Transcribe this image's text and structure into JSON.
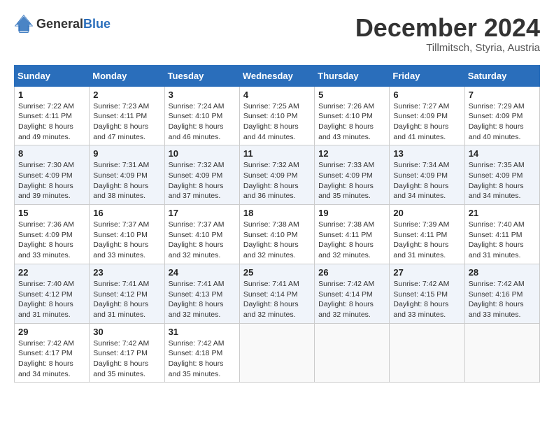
{
  "header": {
    "logo_general": "General",
    "logo_blue": "Blue",
    "month_title": "December 2024",
    "subtitle": "Tillmitsch, Styria, Austria"
  },
  "days_of_week": [
    "Sunday",
    "Monday",
    "Tuesday",
    "Wednesday",
    "Thursday",
    "Friday",
    "Saturday"
  ],
  "weeks": [
    [
      {
        "day": "1",
        "sunrise": "7:22 AM",
        "sunset": "4:11 PM",
        "daylight": "8 hours and 49 minutes."
      },
      {
        "day": "2",
        "sunrise": "7:23 AM",
        "sunset": "4:11 PM",
        "daylight": "8 hours and 47 minutes."
      },
      {
        "day": "3",
        "sunrise": "7:24 AM",
        "sunset": "4:10 PM",
        "daylight": "8 hours and 46 minutes."
      },
      {
        "day": "4",
        "sunrise": "7:25 AM",
        "sunset": "4:10 PM",
        "daylight": "8 hours and 44 minutes."
      },
      {
        "day": "5",
        "sunrise": "7:26 AM",
        "sunset": "4:10 PM",
        "daylight": "8 hours and 43 minutes."
      },
      {
        "day": "6",
        "sunrise": "7:27 AM",
        "sunset": "4:09 PM",
        "daylight": "8 hours and 41 minutes."
      },
      {
        "day": "7",
        "sunrise": "7:29 AM",
        "sunset": "4:09 PM",
        "daylight": "8 hours and 40 minutes."
      }
    ],
    [
      {
        "day": "8",
        "sunrise": "7:30 AM",
        "sunset": "4:09 PM",
        "daylight": "8 hours and 39 minutes."
      },
      {
        "day": "9",
        "sunrise": "7:31 AM",
        "sunset": "4:09 PM",
        "daylight": "8 hours and 38 minutes."
      },
      {
        "day": "10",
        "sunrise": "7:32 AM",
        "sunset": "4:09 PM",
        "daylight": "8 hours and 37 minutes."
      },
      {
        "day": "11",
        "sunrise": "7:32 AM",
        "sunset": "4:09 PM",
        "daylight": "8 hours and 36 minutes."
      },
      {
        "day": "12",
        "sunrise": "7:33 AM",
        "sunset": "4:09 PM",
        "daylight": "8 hours and 35 minutes."
      },
      {
        "day": "13",
        "sunrise": "7:34 AM",
        "sunset": "4:09 PM",
        "daylight": "8 hours and 34 minutes."
      },
      {
        "day": "14",
        "sunrise": "7:35 AM",
        "sunset": "4:09 PM",
        "daylight": "8 hours and 34 minutes."
      }
    ],
    [
      {
        "day": "15",
        "sunrise": "7:36 AM",
        "sunset": "4:09 PM",
        "daylight": "8 hours and 33 minutes."
      },
      {
        "day": "16",
        "sunrise": "7:37 AM",
        "sunset": "4:10 PM",
        "daylight": "8 hours and 33 minutes."
      },
      {
        "day": "17",
        "sunrise": "7:37 AM",
        "sunset": "4:10 PM",
        "daylight": "8 hours and 32 minutes."
      },
      {
        "day": "18",
        "sunrise": "7:38 AM",
        "sunset": "4:10 PM",
        "daylight": "8 hours and 32 minutes."
      },
      {
        "day": "19",
        "sunrise": "7:38 AM",
        "sunset": "4:11 PM",
        "daylight": "8 hours and 32 minutes."
      },
      {
        "day": "20",
        "sunrise": "7:39 AM",
        "sunset": "4:11 PM",
        "daylight": "8 hours and 31 minutes."
      },
      {
        "day": "21",
        "sunrise": "7:40 AM",
        "sunset": "4:11 PM",
        "daylight": "8 hours and 31 minutes."
      }
    ],
    [
      {
        "day": "22",
        "sunrise": "7:40 AM",
        "sunset": "4:12 PM",
        "daylight": "8 hours and 31 minutes."
      },
      {
        "day": "23",
        "sunrise": "7:41 AM",
        "sunset": "4:12 PM",
        "daylight": "8 hours and 31 minutes."
      },
      {
        "day": "24",
        "sunrise": "7:41 AM",
        "sunset": "4:13 PM",
        "daylight": "8 hours and 32 minutes."
      },
      {
        "day": "25",
        "sunrise": "7:41 AM",
        "sunset": "4:14 PM",
        "daylight": "8 hours and 32 minutes."
      },
      {
        "day": "26",
        "sunrise": "7:42 AM",
        "sunset": "4:14 PM",
        "daylight": "8 hours and 32 minutes."
      },
      {
        "day": "27",
        "sunrise": "7:42 AM",
        "sunset": "4:15 PM",
        "daylight": "8 hours and 33 minutes."
      },
      {
        "day": "28",
        "sunrise": "7:42 AM",
        "sunset": "4:16 PM",
        "daylight": "8 hours and 33 minutes."
      }
    ],
    [
      {
        "day": "29",
        "sunrise": "7:42 AM",
        "sunset": "4:17 PM",
        "daylight": "8 hours and 34 minutes."
      },
      {
        "day": "30",
        "sunrise": "7:42 AM",
        "sunset": "4:17 PM",
        "daylight": "8 hours and 35 minutes."
      },
      {
        "day": "31",
        "sunrise": "7:42 AM",
        "sunset": "4:18 PM",
        "daylight": "8 hours and 35 minutes."
      },
      null,
      null,
      null,
      null
    ]
  ],
  "labels": {
    "sunrise": "Sunrise:",
    "sunset": "Sunset:",
    "daylight": "Daylight:"
  }
}
